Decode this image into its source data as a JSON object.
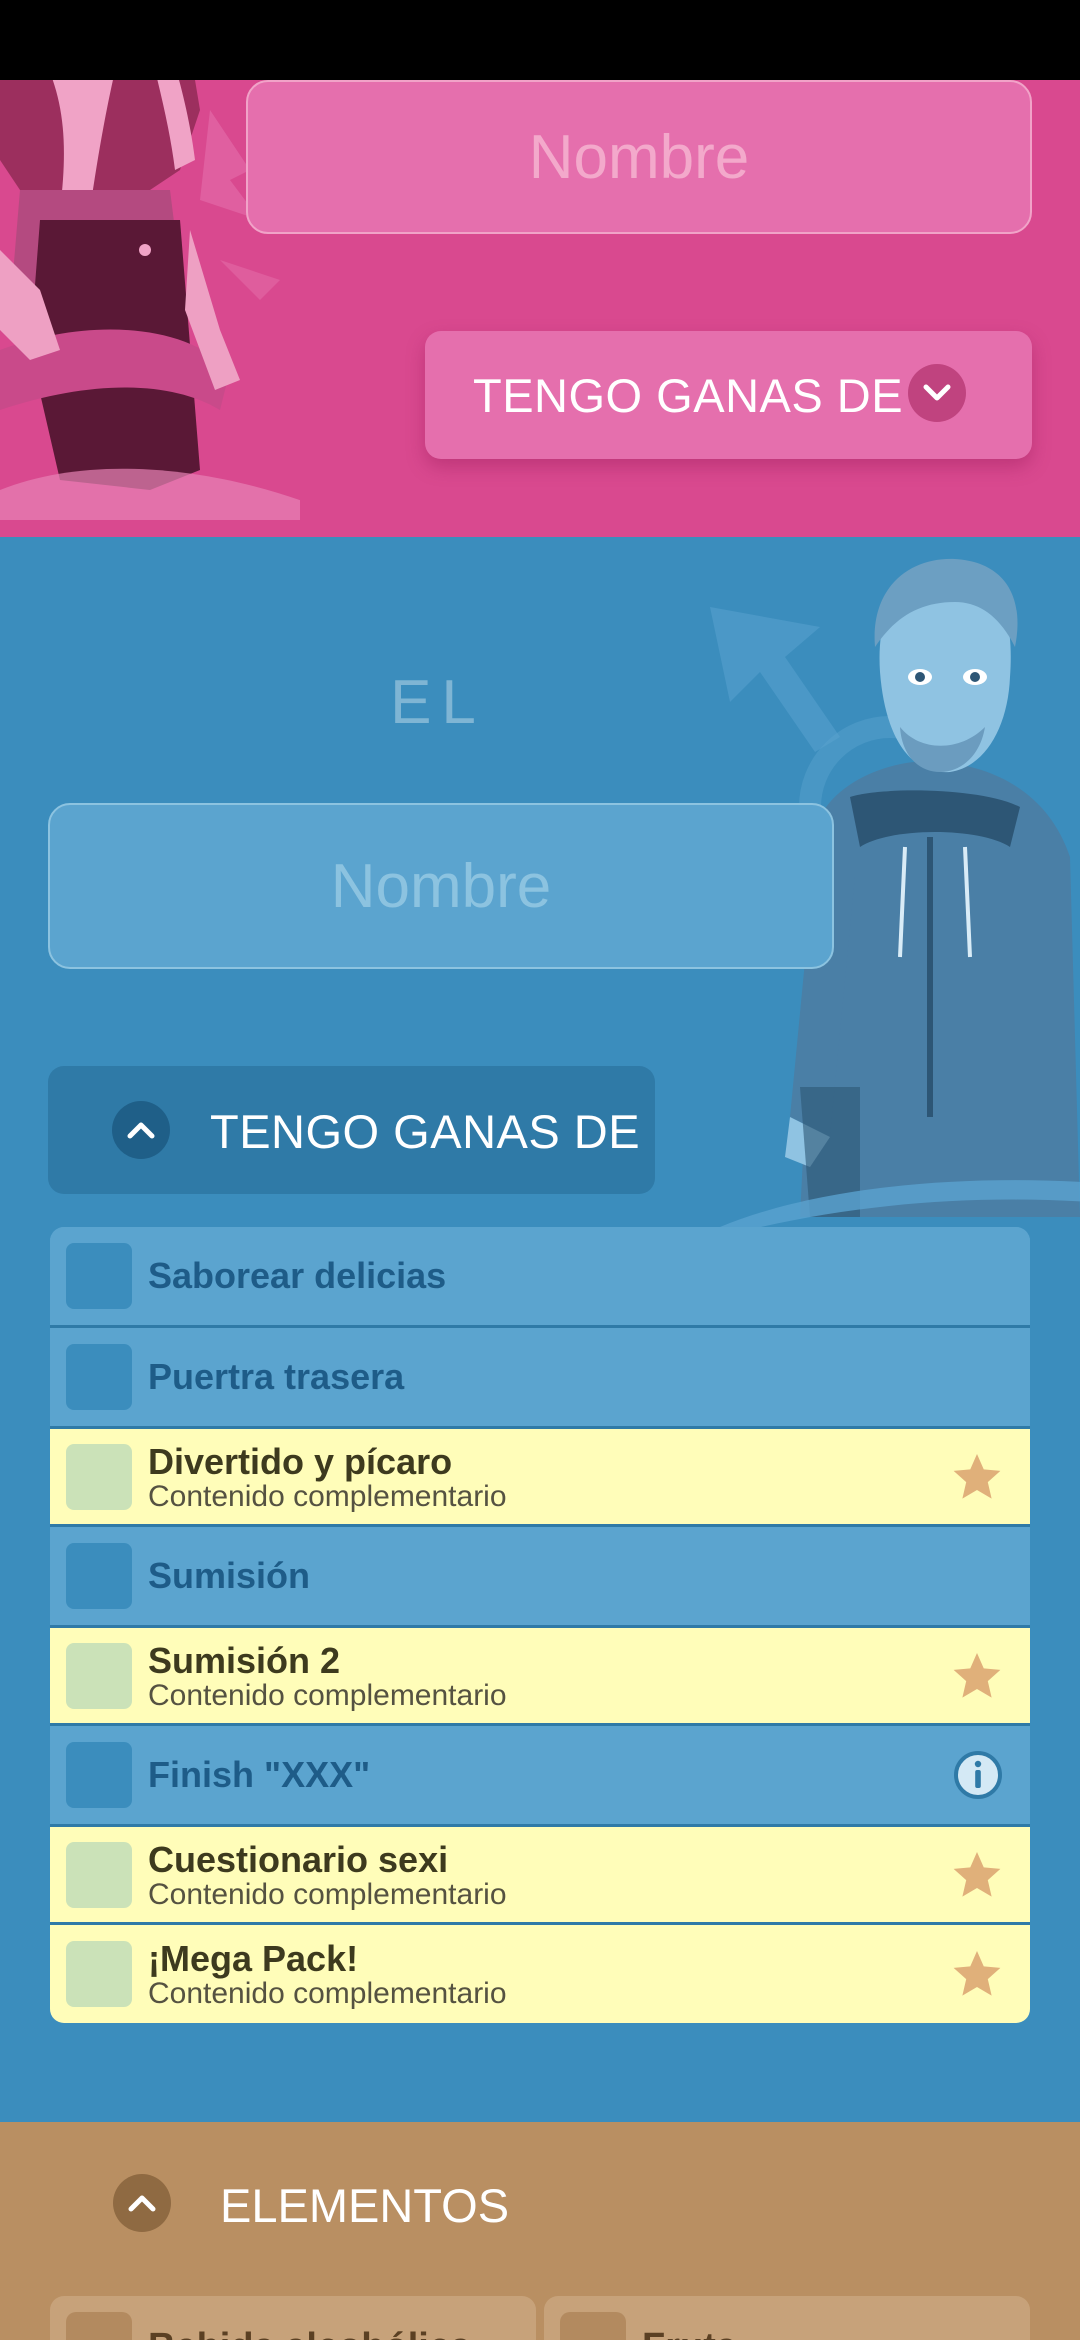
{
  "ella": {
    "name_placeholder": "Nombre",
    "want_button_label": "TENGO GANAS DE"
  },
  "el": {
    "title": "EL",
    "name_placeholder": "Nombre",
    "want_button_label": "TENGO GANAS DE",
    "options": [
      {
        "title": "Saborear delicias",
        "premium": false
      },
      {
        "title": "Puertra trasera",
        "premium": false
      },
      {
        "title": "Divertido y pícaro",
        "subtitle": "Contenido complementario",
        "premium": true,
        "icon": "star-icon"
      },
      {
        "title": "Sumisión",
        "premium": false
      },
      {
        "title": "Sumisión 2",
        "subtitle": "Contenido complementario",
        "premium": true,
        "icon": "star-icon"
      },
      {
        "title": "Finish \"XXX\"",
        "premium": false,
        "icon": "info-icon"
      },
      {
        "title": "Cuestionario sexi",
        "subtitle": "Contenido complementario",
        "premium": true,
        "icon": "star-icon"
      },
      {
        "title": "¡Mega Pack!",
        "subtitle": "Contenido complementario",
        "premium": true,
        "icon": "star-icon"
      }
    ]
  },
  "elements": {
    "header_label": "ELEMENTOS",
    "cards": [
      {
        "label": "Bebida alcohólica"
      },
      {
        "label": "Fruta"
      }
    ]
  },
  "colors": {
    "pink_section": "#d9498f",
    "blue_section": "#3b8dbd",
    "premium_row": "#fffdb9",
    "elements_section": "#b98f62",
    "star": "#e0b07a"
  }
}
